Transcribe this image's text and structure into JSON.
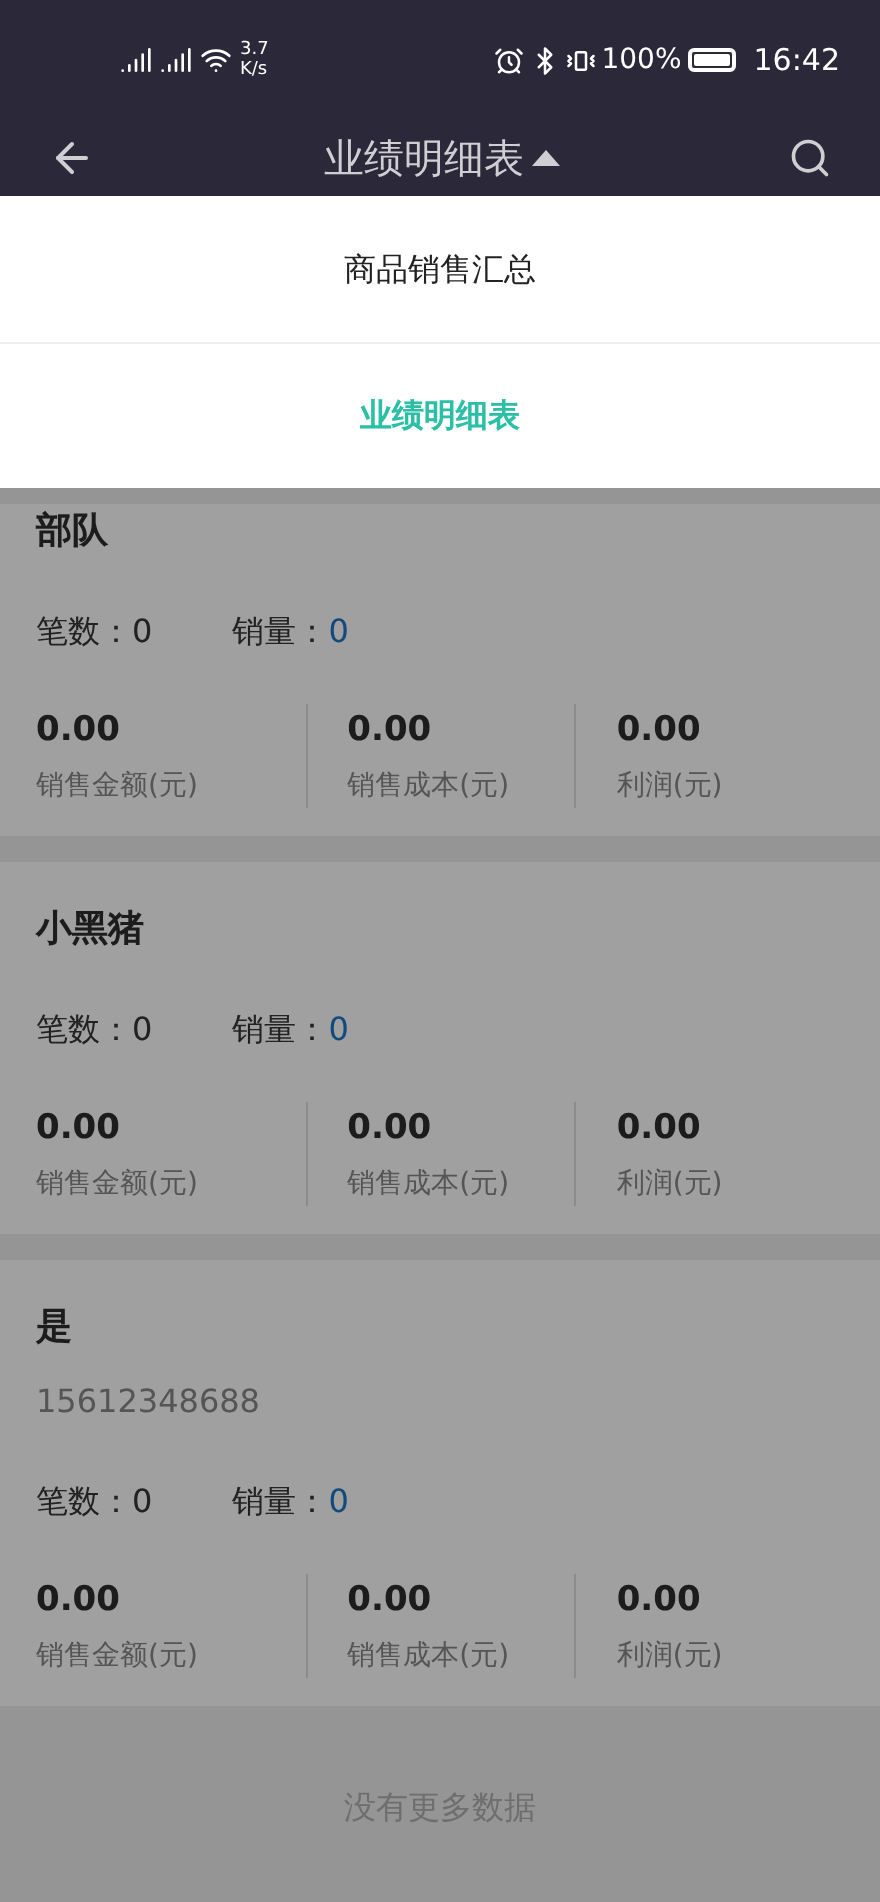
{
  "status_bar": {
    "network_speed": "3.7",
    "network_speed_unit": "K/s",
    "battery": "100%",
    "time": "16:42"
  },
  "nav": {
    "title": "业绩明细表"
  },
  "menu": [
    {
      "label": "商品销售汇总",
      "selected": false
    },
    {
      "label": "业绩明细表",
      "selected": true
    }
  ],
  "cards": [
    {
      "name": "部队",
      "count_label": "笔数：",
      "count": "0",
      "qty_label": "销量：",
      "qty": "0",
      "metrics": [
        {
          "value": "0.00",
          "label": "销售金额(元)"
        },
        {
          "value": "0.00",
          "label": "销售成本(元)"
        },
        {
          "value": "0.00",
          "label": "利润(元)"
        }
      ]
    },
    {
      "name": "小黑猪",
      "count_label": "笔数：",
      "count": "0",
      "qty_label": "销量：",
      "qty": "0",
      "metrics": [
        {
          "value": "0.00",
          "label": "销售金额(元)"
        },
        {
          "value": "0.00",
          "label": "销售成本(元)"
        },
        {
          "value": "0.00",
          "label": "利润(元)"
        }
      ]
    },
    {
      "name": "是",
      "phone": "15612348688",
      "count_label": "笔数：",
      "count": "0",
      "qty_label": "销量：",
      "qty": "0",
      "metrics": [
        {
          "value": "0.00",
          "label": "销售金额(元)"
        },
        {
          "value": "0.00",
          "label": "销售成本(元)"
        },
        {
          "value": "0.00",
          "label": "利润(元)"
        }
      ]
    }
  ],
  "footer": "没有更多数据"
}
